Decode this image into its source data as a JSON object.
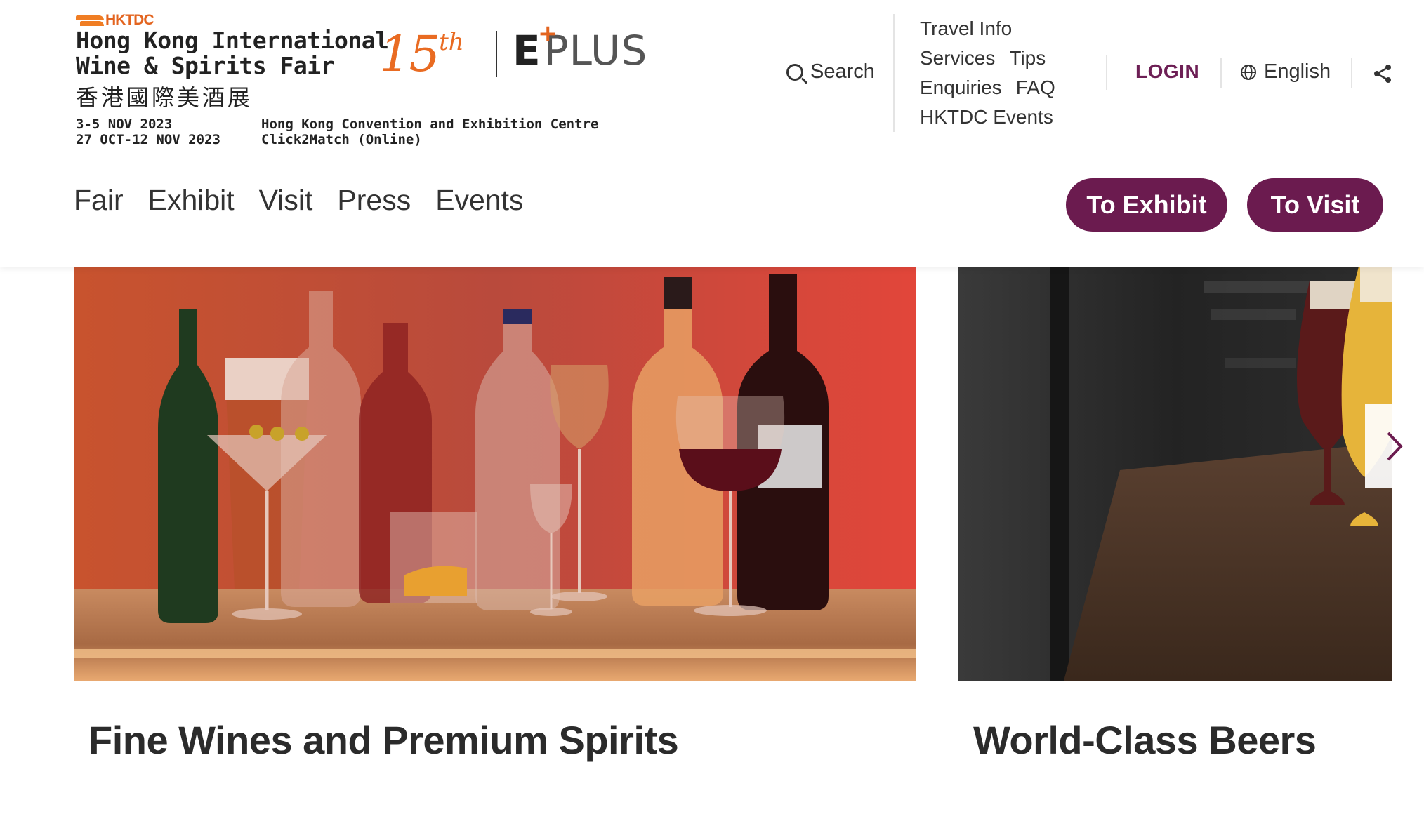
{
  "brand": {
    "name": "HKTDC"
  },
  "fair": {
    "title_line1": "Hong Kong International",
    "title_line2": "Wine & Spirits Fair",
    "title_cn": "香港國際美酒展",
    "anniversary_num": "15",
    "anniversary_suffix": "th",
    "eplus_e": "E",
    "eplus_plus": "+",
    "eplus_word": "PLUS",
    "date_physical": "3-5 NOV 2023",
    "date_online": "27 OCT-12 NOV 2023",
    "venue_physical": "Hong Kong Convention and Exhibition Centre",
    "venue_online": "Click2Match (Online)"
  },
  "header": {
    "search_label": "Search",
    "quick_links": {
      "travel_info": "Travel Info",
      "services": "Services",
      "tips": "Tips",
      "enquiries": "Enquiries",
      "faq": "FAQ",
      "hktdc_events": "HKTDC Events"
    },
    "login_label": "LOGIN",
    "language_label": "English"
  },
  "nav": {
    "items": [
      "Fair",
      "Exhibit",
      "Visit",
      "Press",
      "Events"
    ]
  },
  "cta": {
    "exhibit_label": "To Exhibit",
    "visit_label": "To Visit"
  },
  "cards": [
    {
      "title": "Fine Wines and Premium Spirits"
    },
    {
      "title": "World-Class Beers"
    }
  ],
  "colors": {
    "brand_orange": "#e96b22",
    "accent_plum": "#6b1b4f",
    "text": "#333333"
  },
  "icons": [
    "search-icon",
    "globe-icon",
    "share-icon",
    "chevron-right-icon"
  ]
}
